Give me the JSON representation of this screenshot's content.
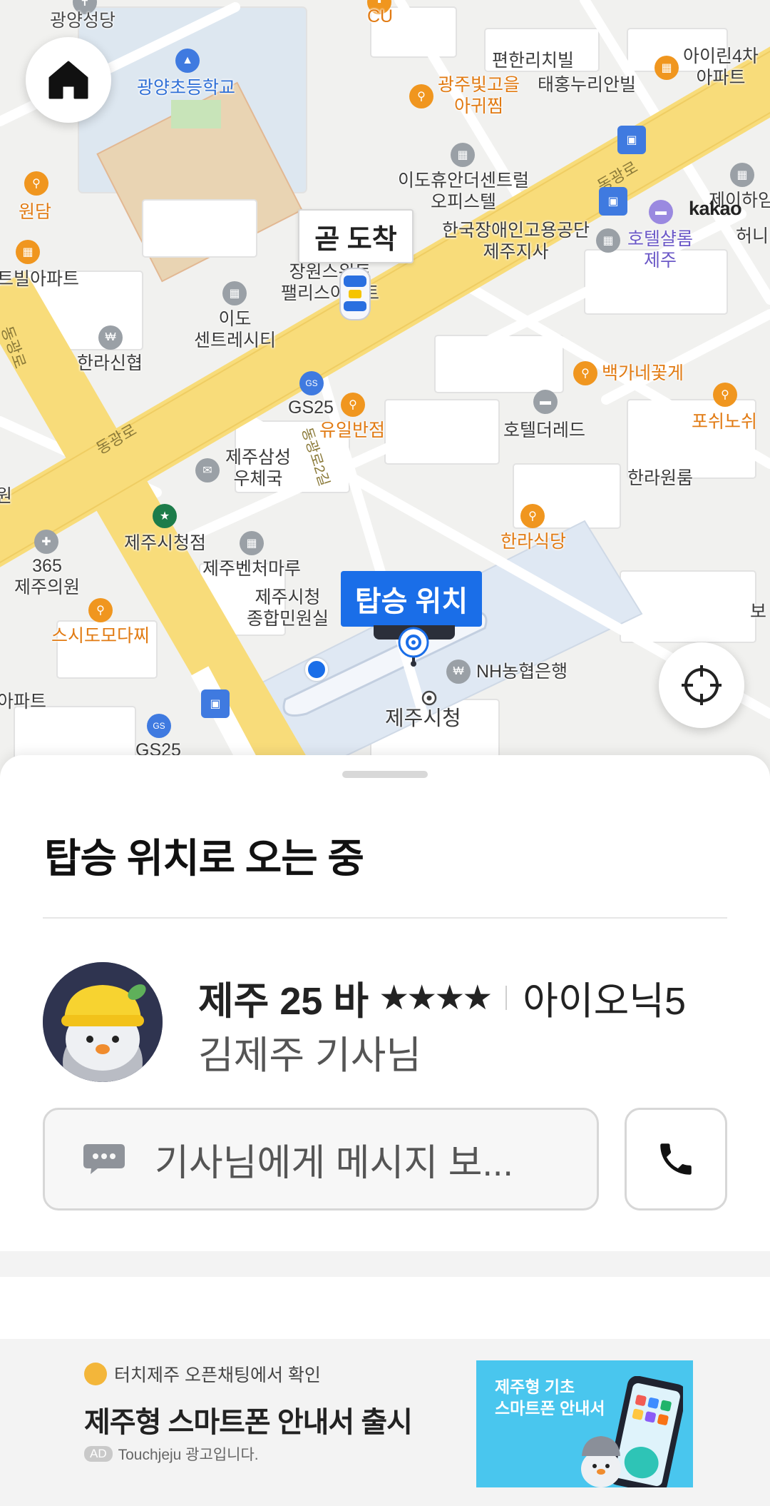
{
  "map": {
    "arrival_label": "곧 도착",
    "pickup_label": "탑승 위치",
    "kakao_logo": "kakao",
    "roads": [
      "동광로",
      "동광로",
      "동광로",
      "동광로2길",
      "동광로"
    ],
    "pois": [
      {
        "name": "광양성당",
        "color": "gray"
      },
      {
        "name": "CU",
        "color": "orange"
      },
      {
        "name": "편한리치빌",
        "color": "dark"
      },
      {
        "name": "아이린4차\n아파트",
        "color": "dark"
      },
      {
        "name": "광양초등학교",
        "color": "blue"
      },
      {
        "name": "광주빛고을\n아귀찜",
        "color": "orange"
      },
      {
        "name": "태홍누리안빌",
        "color": "dark"
      },
      {
        "name": "원담",
        "color": "orange"
      },
      {
        "name": "이도휴안더센트럴\n오피스텔",
        "color": "dark"
      },
      {
        "name": "제이하임",
        "color": "dark"
      },
      {
        "name": "한국장애인고용공단\n제주지사",
        "color": "dark"
      },
      {
        "name": "호텔샬롬\n제주",
        "color": "purple"
      },
      {
        "name": "허니",
        "color": "dark"
      },
      {
        "name": "트빌아파트",
        "color": "dark"
      },
      {
        "name": "장원스위트\n팰리스아파트",
        "color": "dark"
      },
      {
        "name": "이도\n센트레시티",
        "color": "dark"
      },
      {
        "name": "한라신협",
        "color": "dark"
      },
      {
        "name": "백가네꽃게",
        "color": "orange"
      },
      {
        "name": "포쉬노쉬",
        "color": "orange"
      },
      {
        "name": "GS25",
        "color": "dark"
      },
      {
        "name": "유일반점",
        "color": "orange"
      },
      {
        "name": "호텔더레드",
        "color": "dark"
      },
      {
        "name": "제주삼성\n우체국",
        "color": "dark"
      },
      {
        "name": "한라원룸",
        "color": "dark"
      },
      {
        "name": "제주시청점",
        "color": "dark"
      },
      {
        "name": "한라식당",
        "color": "orange"
      },
      {
        "name": "365\n제주의원",
        "color": "dark"
      },
      {
        "name": "제주벤처마루",
        "color": "dark"
      },
      {
        "name": "제주시청\n종합민원실",
        "color": "dark"
      },
      {
        "name": "스시도모다찌",
        "color": "orange"
      },
      {
        "name": "NH농협은행",
        "color": "dark"
      },
      {
        "name": "제주시청",
        "color": "dark"
      },
      {
        "name": "아파트",
        "color": "dark"
      },
      {
        "name": "GS25",
        "color": "dark"
      },
      {
        "name": "원",
        "color": "dark"
      },
      {
        "name": "보",
        "color": "dark"
      }
    ]
  },
  "sheet": {
    "status_title": "탑승 위치로 오는 중",
    "plate": "제주 25 바",
    "stars": "★★★★",
    "car_model": "아이오닉5",
    "driver_name": "김제주 기사님",
    "message_placeholder": "기사님에게 메시지 보...",
    "message_icon": "chat-bubble-icon",
    "call_icon": "phone-icon"
  },
  "ad": {
    "source": "터치제주 오픈채팅에서 확인",
    "headline": "제주형 스마트폰 안내서 출시",
    "badge": "AD",
    "meta": "Touchjeju 광고입니다.",
    "image_text_line1": "제주형 기초",
    "image_text_line2": "스마트폰 안내서"
  },
  "colors": {
    "accent": "#1a6ee8",
    "road_major": "#f8dc7a",
    "map_bg": "#f1f1ef",
    "poi_orange": "#e17a12"
  }
}
